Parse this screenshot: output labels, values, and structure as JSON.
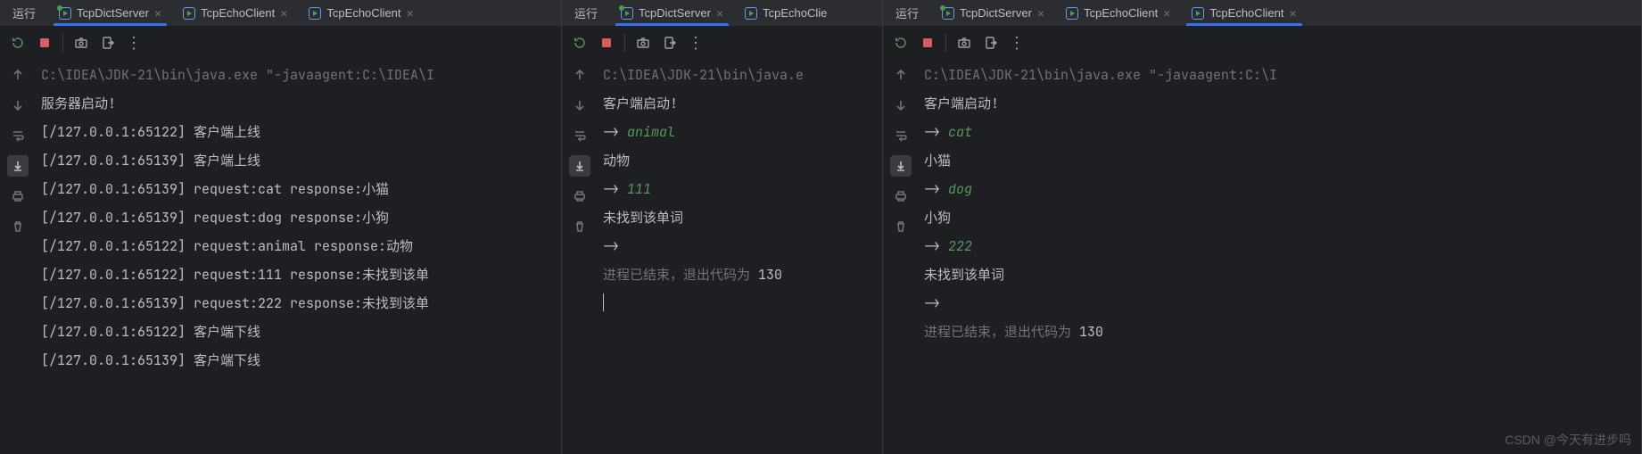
{
  "watermark": "CSDN @今天有进步吗",
  "panes": [
    {
      "runLabel": "运行",
      "tabs": [
        {
          "label": "TcpDictServer",
          "active": true,
          "modified": true
        },
        {
          "label": "TcpEchoClient",
          "active": false,
          "modified": false
        },
        {
          "label": "TcpEchoClient",
          "active": false,
          "modified": false
        }
      ],
      "cmd": "C:\\IDEA\\JDK-21\\bin\\java.exe \"-javaagent:C:\\IDEA\\I",
      "lines": [
        {
          "t": "服务器启动!"
        },
        {
          "t": "[/127.0.0.1:65122] 客户端上线"
        },
        {
          "t": "[/127.0.0.1:65139] 客户端上线"
        },
        {
          "t": "[/127.0.0.1:65139] request:cat response:小猫"
        },
        {
          "t": "[/127.0.0.1:65139] request:dog response:小狗"
        },
        {
          "t": "[/127.0.0.1:65122] request:animal response:动物"
        },
        {
          "t": "[/127.0.0.1:65122] request:111 response:未找到该单"
        },
        {
          "t": "[/127.0.0.1:65139] request:222 response:未找到该单"
        },
        {
          "t": "[/127.0.0.1:65122] 客户端下线"
        },
        {
          "t": "[/127.0.0.1:65139] 客户端下线"
        }
      ]
    },
    {
      "runLabel": "运行",
      "tabs": [
        {
          "label": "TcpDictServer",
          "active": true,
          "modified": true
        },
        {
          "label": "TcpEchoClie",
          "active": false,
          "modified": false
        }
      ],
      "cmd": "C:\\IDEA\\JDK-21\\bin\\java.e",
      "start": "客户端启动!",
      "io": [
        {
          "prompt": "-> ",
          "in": "animal"
        },
        {
          "out": "动物"
        },
        {
          "prompt": "-> ",
          "in": "111"
        },
        {
          "out": "未找到该单词"
        },
        {
          "prompt": "->"
        }
      ],
      "exit": {
        "pre": "进程已结束，退出代码为 ",
        "code": "130"
      },
      "caret": true
    },
    {
      "runLabel": "运行",
      "tabs": [
        {
          "label": "TcpDictServer",
          "active": false,
          "modified": true
        },
        {
          "label": "TcpEchoClient",
          "active": false,
          "modified": false
        },
        {
          "label": "TcpEchoClient",
          "active": true,
          "modified": false
        }
      ],
      "cmd": "C:\\IDEA\\JDK-21\\bin\\java.exe \"-javaagent:C:\\I",
      "start": "客户端启动!",
      "io": [
        {
          "prompt": "-> ",
          "in": "cat"
        },
        {
          "out": "小猫"
        },
        {
          "prompt": "-> ",
          "in": "dog"
        },
        {
          "out": "小狗"
        },
        {
          "prompt": "-> ",
          "in": "222"
        },
        {
          "out": "未找到该单词"
        },
        {
          "prompt": "->"
        }
      ],
      "exit": {
        "pre": "进程已结束，退出代码为 ",
        "code": "130"
      }
    }
  ]
}
